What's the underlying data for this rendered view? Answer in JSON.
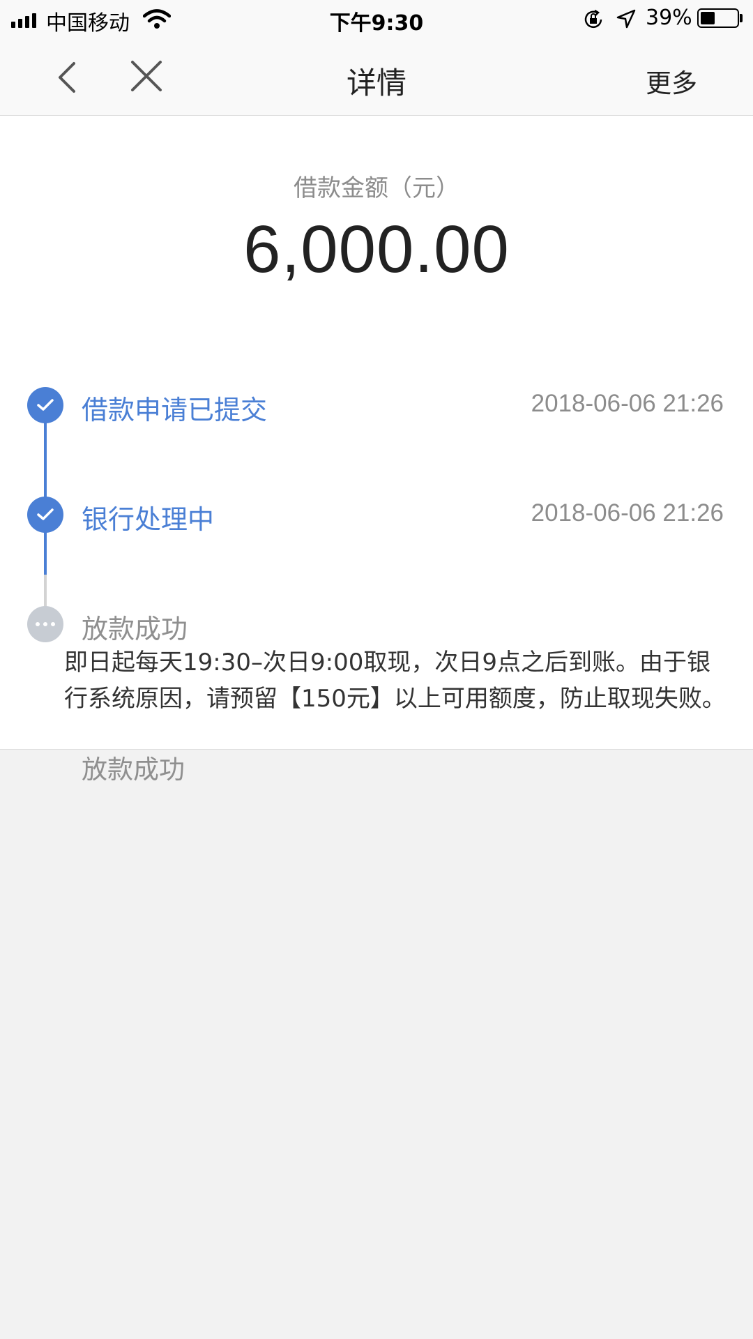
{
  "status_bar": {
    "carrier": "中国移动",
    "time": "下午9:30",
    "battery_percent_label": "39%",
    "battery_level": 0.39,
    "icons": [
      "signal-icon",
      "wifi-icon",
      "rotation-lock-icon",
      "location-icon",
      "battery-icon"
    ]
  },
  "nav": {
    "title": "详情",
    "more_label": "更多",
    "icons": [
      "back-chevron-icon",
      "close-icon"
    ]
  },
  "amount": {
    "label": "借款金额（元）",
    "value": "6,000.00"
  },
  "timeline": [
    {
      "title": "借款申请已提交",
      "time": "2018-06-06 21:26",
      "state": "done"
    },
    {
      "title": "银行处理中",
      "time": "2018-06-06 21:26",
      "state": "done"
    },
    {
      "title": "放款成功",
      "time": "",
      "state": "pending"
    }
  ],
  "notice": "即日起每天19:30–次日9:00取现，次日9点之后到账。由于银行系统原因，请预留【150元】以上可用额度，防止取现失败。",
  "below_status": "放款成功",
  "colors": {
    "accent": "#4a7fd5",
    "pending": "#c7ccd3",
    "background": "#f2f2f2"
  }
}
